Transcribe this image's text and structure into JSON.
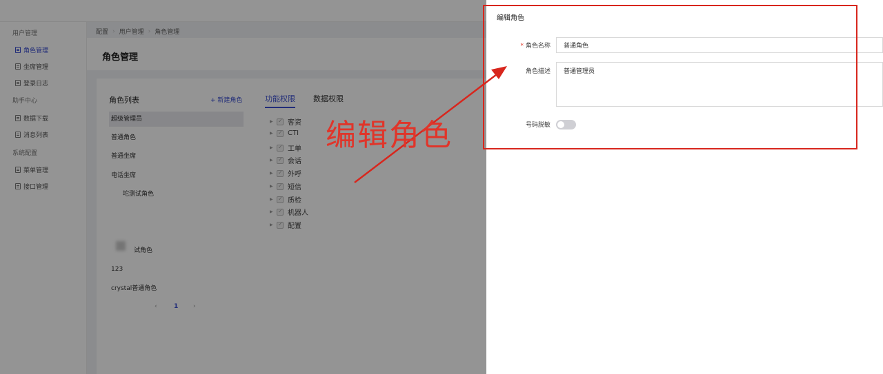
{
  "sidebar": {
    "groups": [
      {
        "label": "用户管理"
      },
      {
        "label": "助手中心"
      },
      {
        "label": "系统配置"
      }
    ],
    "items": [
      {
        "label": "角色管理",
        "active": true
      },
      {
        "label": "坐席管理"
      },
      {
        "label": "登录日志"
      },
      {
        "label": "数据下载"
      },
      {
        "label": "消息列表"
      },
      {
        "label": "菜单管理"
      },
      {
        "label": "接口管理"
      }
    ]
  },
  "breadcrumb": [
    "配置",
    "用户管理",
    "角色管理"
  ],
  "page": {
    "title": "角色管理"
  },
  "role_list": {
    "title": "角色列表",
    "new_button": "+ 新建角色",
    "roles": [
      "超级管理员",
      "普通角色",
      "普通坐席",
      "电话坐席",
      "坨测试角色",
      "试角色",
      "123",
      "crystal普通角色"
    ],
    "selected_index": 0
  },
  "pagination": {
    "prev": "‹",
    "current": "1",
    "next": "›"
  },
  "tabs": [
    {
      "label": "功能权限",
      "active": true
    },
    {
      "label": "数据权限"
    }
  ],
  "permissions": [
    "客资",
    "CTI",
    "工单",
    "会话",
    "外呼",
    "短信",
    "质检",
    "机器人",
    "配置"
  ],
  "drawer": {
    "title": "编辑角色",
    "fields": {
      "name_label": "角色名称",
      "name_value": "普通角色",
      "desc_label": "角色描述",
      "desc_value": "普通管理员",
      "mask_label": "号码脱敏",
      "mask_on": false
    }
  },
  "annotation": {
    "text": "编辑角色",
    "color": "#e0352a"
  }
}
